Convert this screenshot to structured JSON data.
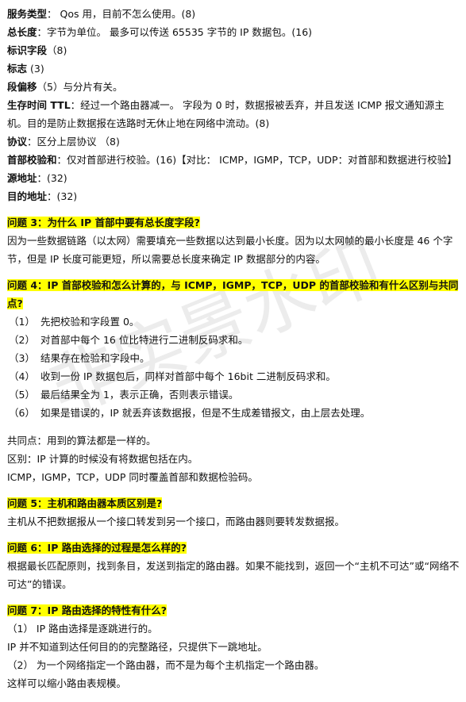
{
  "fields": [
    {
      "label": "服务类型",
      "text": "：  Qos 用，目前不怎么使用。(8)"
    },
    {
      "label": "总长度",
      "text": "：字节为单位。  最多可以传送 65535 字节的 IP 数据包。(16)"
    },
    {
      "label": "标识字段",
      "text": "（8)"
    },
    {
      "label": "标志",
      "text": "  (3)"
    },
    {
      "label": "段偏移",
      "text": "（5）与分片有关。"
    },
    {
      "label": "生存时间 TTL",
      "text": "：经过一个路由器减一。  字段为 0 时，数据报被丢弃，并且发送 ICMP 报文通知源主机。目的是防止数据报在选路时无休止地在网络中流动。(8)"
    },
    {
      "label": "协议",
      "text": "：区分上层协议  （8)"
    },
    {
      "label": "首部校验和",
      "text": "：仅对首部进行校验。(16)【对比：  ICMP，IGMP，TCP，UDP：对首部和数据进行校验】"
    },
    {
      "label": "源地址",
      "text": "：(32)"
    },
    {
      "label": "目的地址",
      "text": "：(32)"
    }
  ],
  "q3": {
    "title": "问题 3：为什么 IP 首部中要有总长度字段?",
    "body": "因为一些数据链路（以太网）需要填充一些数据以达到最小长度。因为以太网帧的最小长度是 46 个字节，但是 IP 长度可能更短，所以需要总长度来确定 IP 数据部分的内容。"
  },
  "q4": {
    "title": "问题 4：IP 首部校验和怎么计算的，与 ICMP，IGMP，TCP，UDP 的首部校验和有什么区别与共同点?",
    "steps": [
      {
        "num": "（1）",
        "text": "先把校验和字段置 0。"
      },
      {
        "num": "（2）",
        "text": "对首部中每个 16 位比特进行二进制反码求和。"
      },
      {
        "num": "（3）",
        "text": "结果存在检验和字段中。"
      },
      {
        "num": "（4）",
        "text": "收到一份 IP 数据包后，同样对首部中每个 16bit 二进制反码求和。"
      },
      {
        "num": "（5）",
        "text": "最后结果全为 1，表示正确，否则表示错误。"
      },
      {
        "num": "（6）",
        "text": "如果是错误的，IP 就丢弃该数据报，但是不生成差错报文，由上层去处理。"
      }
    ],
    "common": "共同点：用到的算法都是一样的。",
    "diff": "区别：IP 计算的时候没有将数据包括在内。",
    "cover": "ICMP，IGMP，TCP，UDP 同时覆盖首部和数据检验码。"
  },
  "q5": {
    "title": "问题 5：主机和路由器本质区别是?",
    "body": "主机从不把数据报从一个接口转发到另一个接口，而路由器则要转发数据报。"
  },
  "q6": {
    "title": "问题 6：IP 路由选择的过程是怎么样的?",
    "body": "根据最长匹配原则，找到条目，发送到指定的路由器。如果不能找到，返回一个“主机不可达”或“网络不可达”的错误。"
  },
  "q7": {
    "title": "问题 7：IP 路由选择的特性有什么?",
    "lines": [
      "（1）  IP 路由选择是逐跳进行的。",
      "IP 并不知道到达任何目的的完整路径，只提供下一跳地址。",
      "（2）  为一个网络指定一个路由器，而不是为每个主机指定一个路由器。",
      "这样可以缩小路由表规模。"
    ]
  },
  "watermark": "非实景水印"
}
